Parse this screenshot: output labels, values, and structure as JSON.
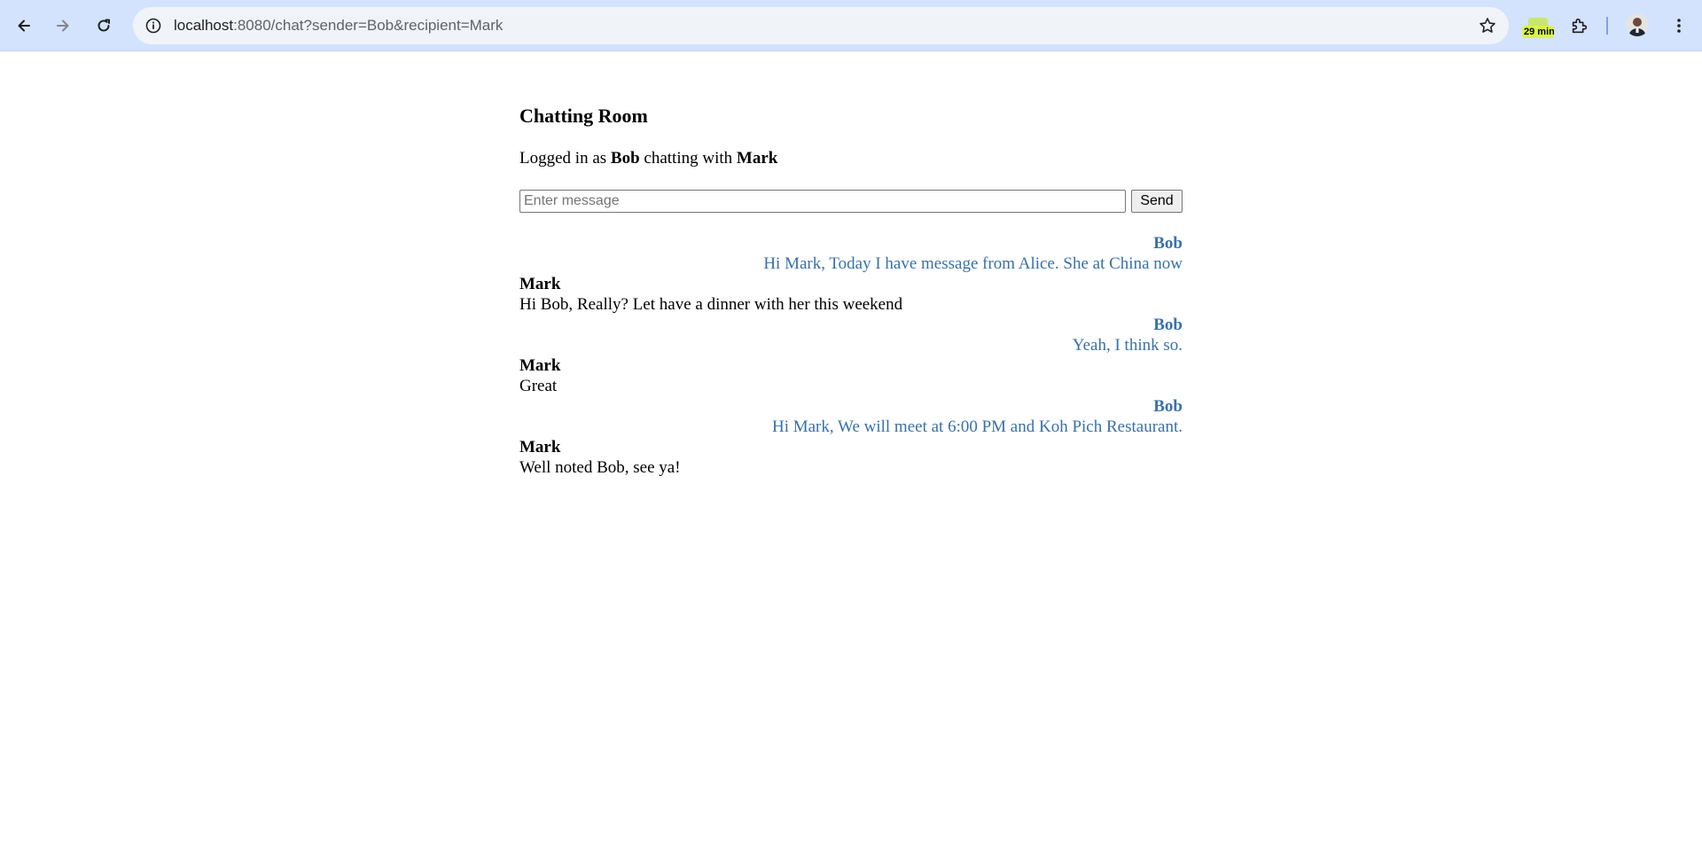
{
  "browser": {
    "url_host": "localhost",
    "url_rest": ":8080/chat?sender=Bob&recipient=Mark",
    "extension_badge": "29 min"
  },
  "page": {
    "title": "Chatting Room",
    "status_prefix": "Logged in as",
    "status_user": "Bob",
    "status_middle": "chatting with",
    "status_recipient": "Mark",
    "input_placeholder": "Enter message",
    "send_label": "Send"
  },
  "messages": [
    {
      "sender": "Bob",
      "text": "Hi Mark, Today I have message from Alice. She at China now",
      "self": true
    },
    {
      "sender": "Mark",
      "text": "Hi Bob, Really? Let have a dinner with her this weekend",
      "self": false
    },
    {
      "sender": "Bob",
      "text": "Yeah, I think so.",
      "self": true
    },
    {
      "sender": "Mark",
      "text": "Great",
      "self": false
    },
    {
      "sender": "Bob",
      "text": "Hi Mark, We will meet at 6:00 PM and Koh Pich Restaurant.",
      "self": true
    },
    {
      "sender": "Mark",
      "text": "Well noted Bob, see ya!",
      "self": false
    }
  ],
  "colors": {
    "chrome_bg": "#d3e3fd",
    "self_message": "#3871a8",
    "other_message": "#000000"
  }
}
